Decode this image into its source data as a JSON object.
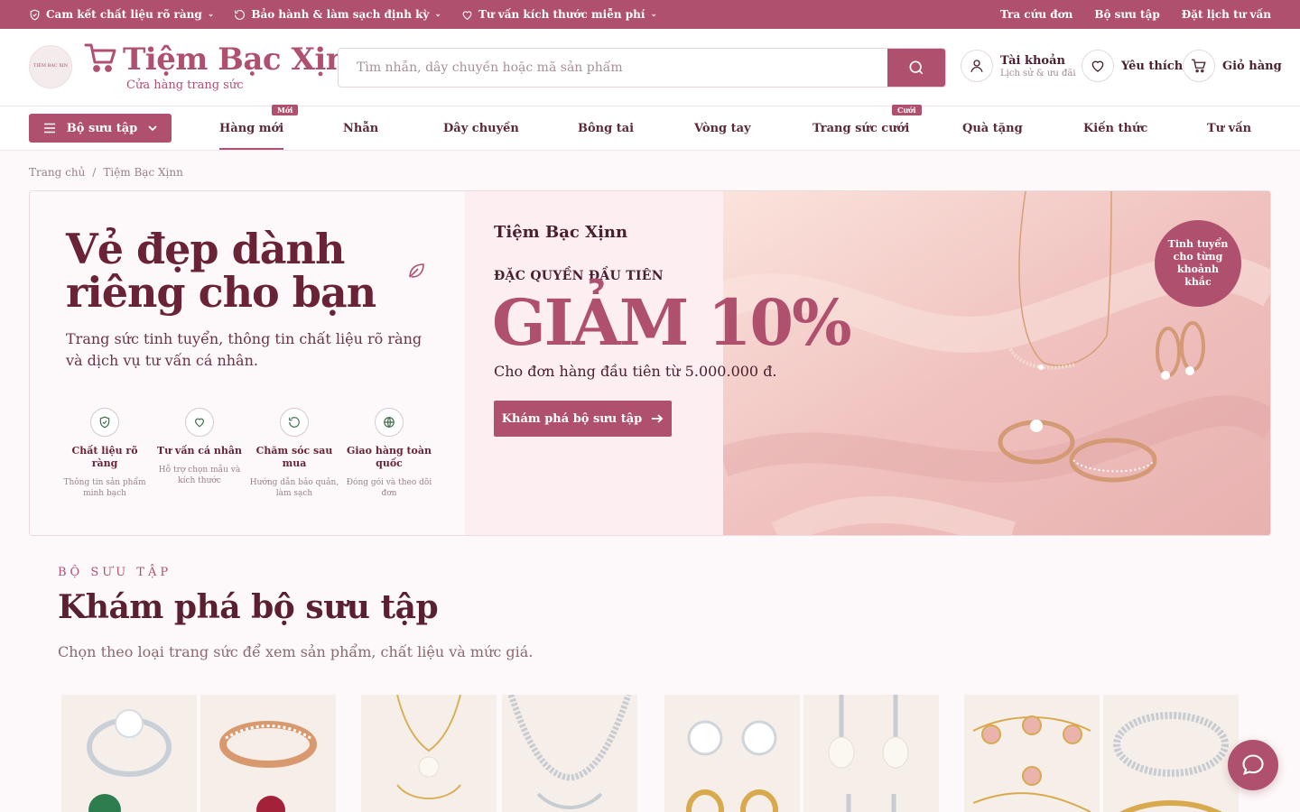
{
  "topbar": {
    "promises": [
      {
        "label": "Cam kết chất liệu rõ ràng",
        "icon": "shield-check-icon"
      },
      {
        "label": "Bảo hành & làm sạch định kỳ",
        "icon": "refresh-icon"
      },
      {
        "label": "Tư vấn kích thước miễn phí",
        "icon": "heart-icon"
      }
    ],
    "links": [
      "Tra cứu đơn",
      "Bộ sưu tập",
      "Đặt lịch tư vấn"
    ]
  },
  "header": {
    "logo_badge_text": "TIỆM BẠC XỊN",
    "brand_name": "Tiệm Bạc Xịnn",
    "brand_tagline": "Cửa hàng trang sức",
    "search_placeholder": "Tìm nhẫn, dây chuyền hoặc mã sản phẩm",
    "account_title": "Tài khoản",
    "account_sub": "Lịch sử & ưu đãi",
    "wishlist_label": "Yêu thích",
    "cart_label": "Giỏ hàng"
  },
  "nav": {
    "category_button": "Bộ sưu tập",
    "items": [
      {
        "label": "Hàng mới",
        "badge": "Mới"
      },
      {
        "label": "Nhẫn",
        "badge": ""
      },
      {
        "label": "Dây chuyền",
        "badge": ""
      },
      {
        "label": "Bông tai",
        "badge": ""
      },
      {
        "label": "Vòng tay",
        "badge": ""
      },
      {
        "label": "Trang sức cưới",
        "badge": "Cưới"
      },
      {
        "label": "Quà tặng",
        "badge": ""
      },
      {
        "label": "Kiến thức",
        "badge": ""
      },
      {
        "label": "Tư vấn",
        "badge": ""
      }
    ],
    "active_index": 0
  },
  "breadcrumb": [
    "Trang chủ",
    "/",
    "Tiệm Bạc Xịnn"
  ],
  "hero": {
    "title_line1": "Vẻ đẹp dành",
    "title_line2": "riêng cho bạn",
    "description": "Trang sức tinh tuyển, thông tin chất liệu rõ ràng và dịch vụ tư vấn cá nhân.",
    "features": [
      {
        "title": "Chất liệu rõ ràng",
        "desc": "Thông tin sản phẩm minh bạch",
        "icon": "shield-check-icon"
      },
      {
        "title": "Tư vấn cá nhân",
        "desc": "Hỗ trợ chọn mẫu và kích thước",
        "icon": "heart-icon"
      },
      {
        "title": "Chăm sóc sau mua",
        "desc": "Hướng dẫn bảo quản, làm sạch",
        "icon": "refresh-icon"
      },
      {
        "title": "Giao hàng toàn quốc",
        "desc": "Đóng gói và theo dõi đơn",
        "icon": "globe-icon"
      }
    ],
    "promo_brand": "Tiệm Bạc Xịnn",
    "promo_kicker": "ĐẶC QUYỀN ĐẦU TIÊN",
    "promo_headline": "GIẢM 10%",
    "promo_condition": "Cho đơn hàng đầu tiên từ 5.000.000 đ.",
    "promo_button": "Khám phá bộ sưu tập",
    "stamp_text": "Tinh tuyển cho từng khoảnh khắc"
  },
  "collection": {
    "kicker": "BỘ SƯU TẬP",
    "title": "Khám phá bộ sưu tập",
    "description": "Chọn theo loại trang sức để xem sản phẩm, chất liệu và mức giá."
  },
  "colors": {
    "brand": "#b0506f",
    "dark_text": "#5a2a38",
    "hero_pink": "#fdeef2"
  }
}
